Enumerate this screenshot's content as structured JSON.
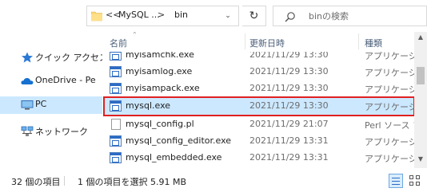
{
  "address_bar": {
    "chevrons": "<<",
    "crumbs": [
      "MySQL ...",
      "bin"
    ],
    "separator": ">",
    "dropdown_icon": "chevron-down-icon",
    "refresh_icon": "refresh-icon"
  },
  "search": {
    "placeholder": "binの検索",
    "icon": "search-icon"
  },
  "nav": {
    "items": [
      {
        "label": "クイック アクセス",
        "icon": "star-icon"
      },
      {
        "label": "OneDrive - Pe",
        "icon": "cloud-icon"
      },
      {
        "label": "PC",
        "icon": "computer-icon"
      },
      {
        "label": "ネットワーク",
        "icon": "network-icon"
      }
    ]
  },
  "columns": {
    "name": "名前",
    "date": "更新日時",
    "type": "種類"
  },
  "files": [
    {
      "name": "myisamchk.exe",
      "date": "2021/11/29 13:30",
      "type": "アプリケーション",
      "icon": "exe-icon"
    },
    {
      "name": "myisamlog.exe",
      "date": "2021/11/29 13:30",
      "type": "アプリケーション",
      "icon": "exe-icon"
    },
    {
      "name": "myisampack.exe",
      "date": "2021/11/29 13:30",
      "type": "アプリケーション",
      "icon": "exe-icon"
    },
    {
      "name": "mysql.exe",
      "date": "2021/11/29 13:30",
      "type": "アプリケーション",
      "icon": "exe-icon",
      "selected": true
    },
    {
      "name": "mysql_config.pl",
      "date": "2021/11/29 21:07",
      "type": "Perl ソース ファイル",
      "icon": "document-icon"
    },
    {
      "name": "mysql_config_editor.exe",
      "date": "2021/11/29 13:31",
      "type": "アプリケーション",
      "icon": "exe-icon"
    },
    {
      "name": "mysql_embedded.exe",
      "date": "2021/11/29 13:31",
      "type": "アプリケーション",
      "icon": "exe-icon"
    }
  ],
  "status": {
    "item_count": "32 個の項目",
    "selection": "1 個の項目を選択  5.91 MB"
  },
  "colors": {
    "selection_bg": "#cce8ff",
    "highlight_border": "#e02020",
    "header_text": "#4c607a"
  }
}
